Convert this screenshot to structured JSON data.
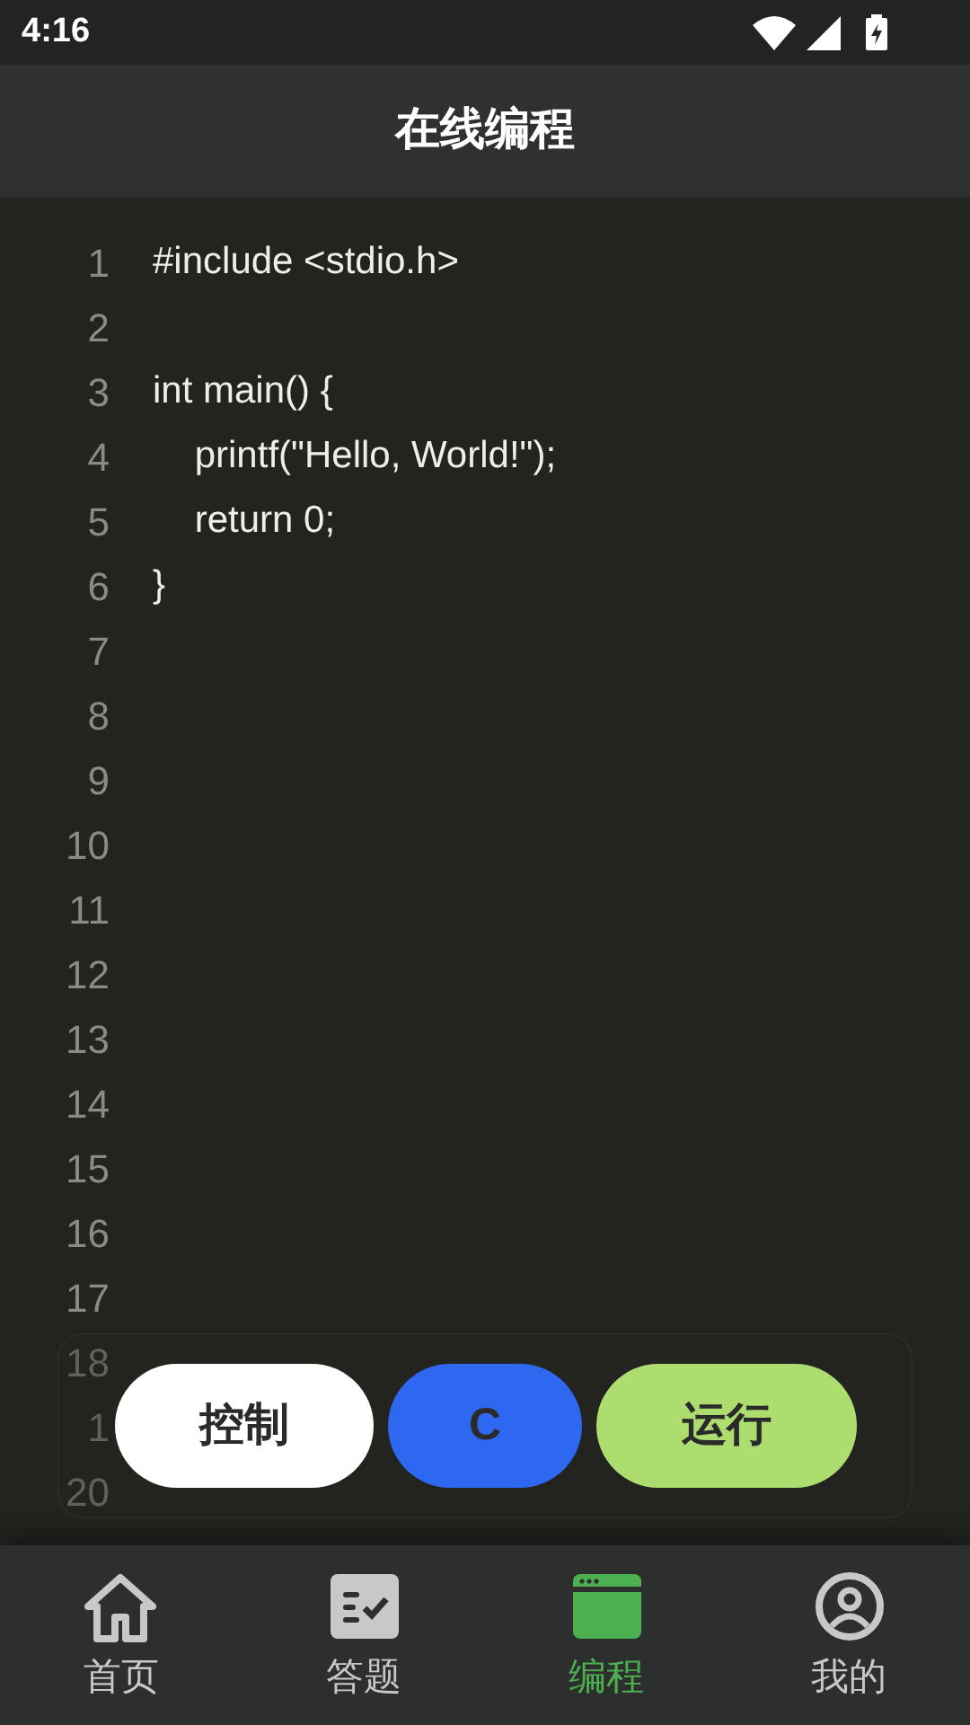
{
  "status_bar": {
    "time": "4:16"
  },
  "header": {
    "title": "在线编程"
  },
  "editor": {
    "lines": [
      {
        "number": "1",
        "code": "#include <stdio.h>"
      },
      {
        "number": "2"
      },
      {
        "number": "3",
        "code": "int main() {"
      },
      {
        "number": "4",
        "code": "    printf(\"Hello, World!\");"
      },
      {
        "number": "5",
        "code": "    return 0;"
      },
      {
        "number": "6",
        "code": "}"
      },
      {
        "number": "7"
      },
      {
        "number": "8"
      },
      {
        "number": "9"
      },
      {
        "number": "10"
      },
      {
        "number": "11"
      },
      {
        "number": "12"
      },
      {
        "number": "13"
      },
      {
        "number": "14"
      },
      {
        "number": "15"
      },
      {
        "number": "16"
      },
      {
        "number": "17"
      },
      {
        "number": "18"
      },
      {
        "number": "1"
      },
      {
        "number": "20"
      }
    ]
  },
  "actions": [
    {
      "label": "控制",
      "kind": "control"
    },
    {
      "label": "C",
      "kind": "language"
    },
    {
      "label": "运行",
      "kind": "run"
    }
  ],
  "nav": [
    {
      "label": "首页",
      "selected": false
    },
    {
      "label": "答题",
      "selected": false
    },
    {
      "label": "编程",
      "selected": true
    },
    {
      "label": "我的",
      "selected": false
    }
  ]
}
